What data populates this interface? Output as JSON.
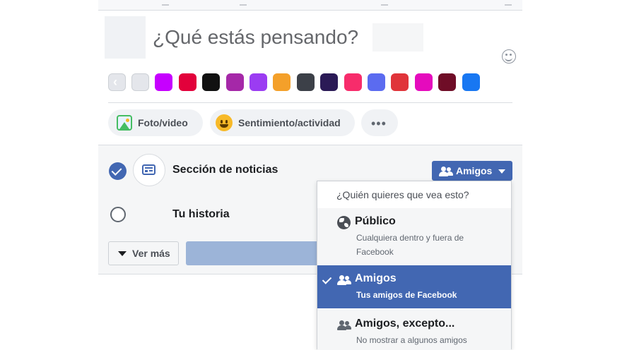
{
  "composer": {
    "prompt": "¿Qué estás pensando?",
    "swatch_colors": [
      "#e4e6eb",
      "#c600ff",
      "#e2013b",
      "#111111",
      "#a528a8",
      "#9b3cf2",
      "#f4a02a",
      "#3c4048",
      "#2b1a56",
      "#f72c6b",
      "#5b6bf0",
      "#e0343a",
      "#e50bbd",
      "#6f0d27",
      "#1877f2"
    ],
    "actions": {
      "photo_label": "Foto/video",
      "feeling_label": "Sentimiento/actividad",
      "more_label": "•••"
    }
  },
  "share": {
    "news_feed_label": "Sección de noticias",
    "story_label": "Tu historia",
    "audience_button_label": "Amigos",
    "see_more_label": "Ver más"
  },
  "audience_dropdown": {
    "header": "¿Quién quieres que vea esto?",
    "options": [
      {
        "title": "Público",
        "description": "Cualquiera dentro y fuera de Facebook",
        "selected": false
      },
      {
        "title": "Amigos",
        "description": "Tus amigos de Facebook",
        "selected": true
      },
      {
        "title": "Amigos, excepto...",
        "description": "No mostrar a algunos amigos",
        "selected": false
      }
    ]
  },
  "colors": {
    "brand_blue": "#4267b2",
    "selected_row": "#4267b2",
    "publish_disabled": "#9cb4d8"
  }
}
